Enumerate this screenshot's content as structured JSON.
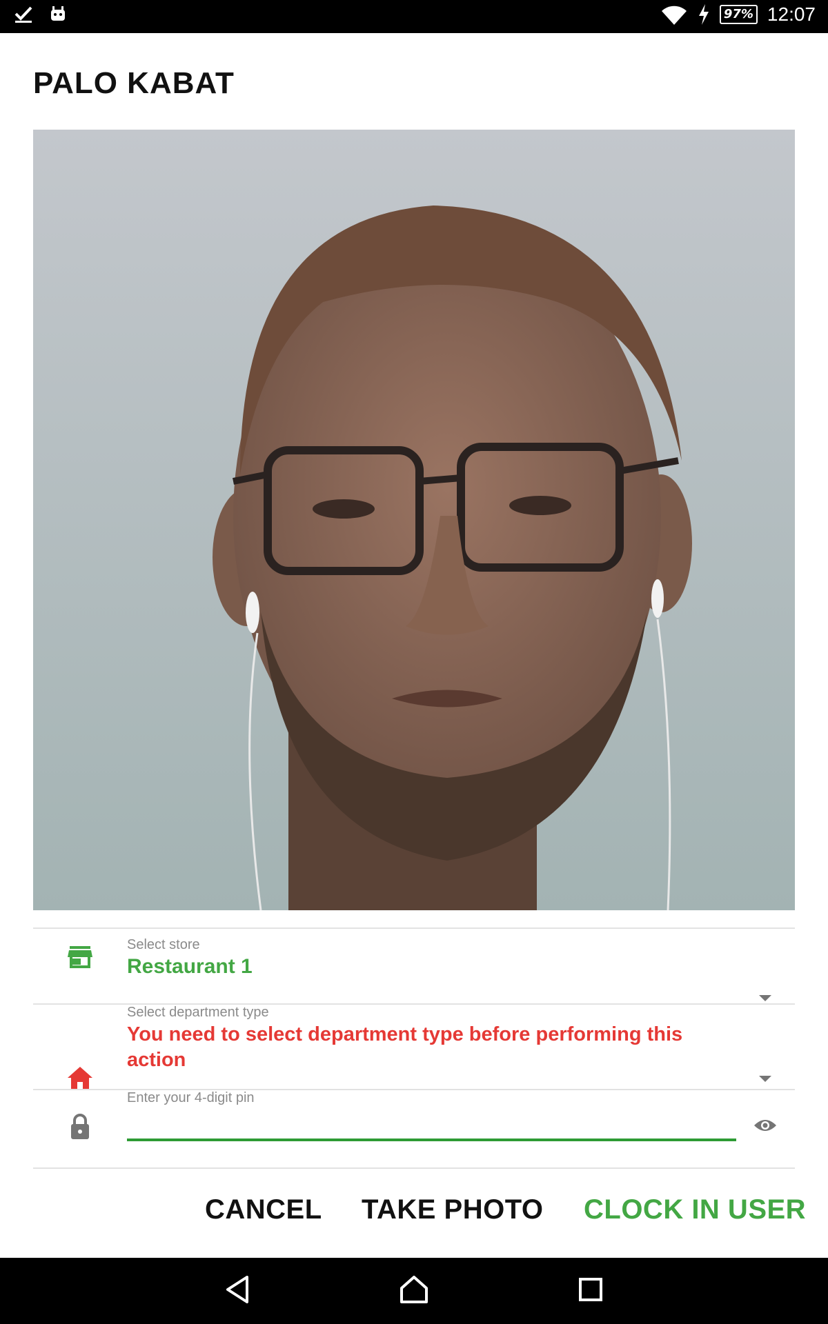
{
  "status_bar": {
    "battery": "97%",
    "time": "12:07",
    "icons": [
      "check-icon",
      "android-icon",
      "wifi-icon",
      "charging-icon",
      "battery-icon"
    ]
  },
  "dialog": {
    "title": "PALO KABAT",
    "photo_alt": "User photo",
    "store": {
      "label": "Select store",
      "value": "Restaurant 1",
      "icon": "store-icon",
      "color": "#43a744"
    },
    "department": {
      "label": "Select department type",
      "error": "You need to select department type before performing this action",
      "icon": "home-icon",
      "color": "#e53935"
    },
    "pin": {
      "label": "Enter your 4-digit pin",
      "value": "",
      "icon": "lock-icon",
      "toggle_icon": "eye-icon"
    },
    "buttons": {
      "cancel": "CANCEL",
      "take_photo": "TAKE PHOTO",
      "clock_in": "CLOCK IN USER"
    }
  },
  "nav_bar": {
    "icons": [
      "back-icon",
      "home-nav-icon",
      "recents-icon"
    ]
  }
}
